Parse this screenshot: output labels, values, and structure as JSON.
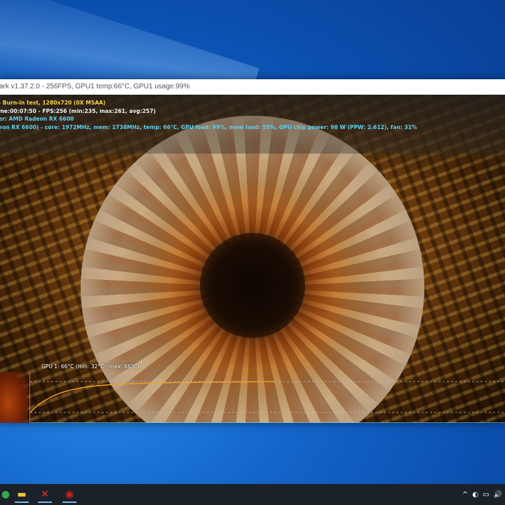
{
  "window": {
    "title": "ark v1.37.2.0 - 256FPS, GPU1 temp:66°C, GPU1 usage:99%"
  },
  "osd": {
    "line1": "- Burn-in test, 1280x720 (0X MSAA)",
    "line2": "me:00:07:50 - FPS:256 (min:235, max:261, avg:257)",
    "line3": "er: AMD Radeon RX 6600",
    "line4": "eon RX 6600) - core: 1972MHz, mem: 1738MHz, temp: 66°C, GPU load: 99%, mem load: 55%, GPU chip power: 98 W (PPW: 2.612), fan: 31%"
  },
  "graph": {
    "label": "GPU 1: 66°C (min: 32°C - max: 66°C)",
    "line_color": "#f0a030",
    "min": 32,
    "max": 66,
    "current": 66
  },
  "taskbar": {
    "items": [
      {
        "name": "chrome-icon",
        "glyph": "●",
        "color": "#34a853"
      },
      {
        "name": "file-explorer-icon",
        "glyph": "▬",
        "color": "#f3c343"
      },
      {
        "name": "app-x-icon",
        "glyph": "✕",
        "color": "#e2332d"
      },
      {
        "name": "furmark-icon",
        "glyph": "◉",
        "color": "#d22222"
      }
    ],
    "tray": {
      "chevron": "^",
      "app_icon": "◐",
      "network": "▭",
      "volume": "🔊"
    }
  }
}
